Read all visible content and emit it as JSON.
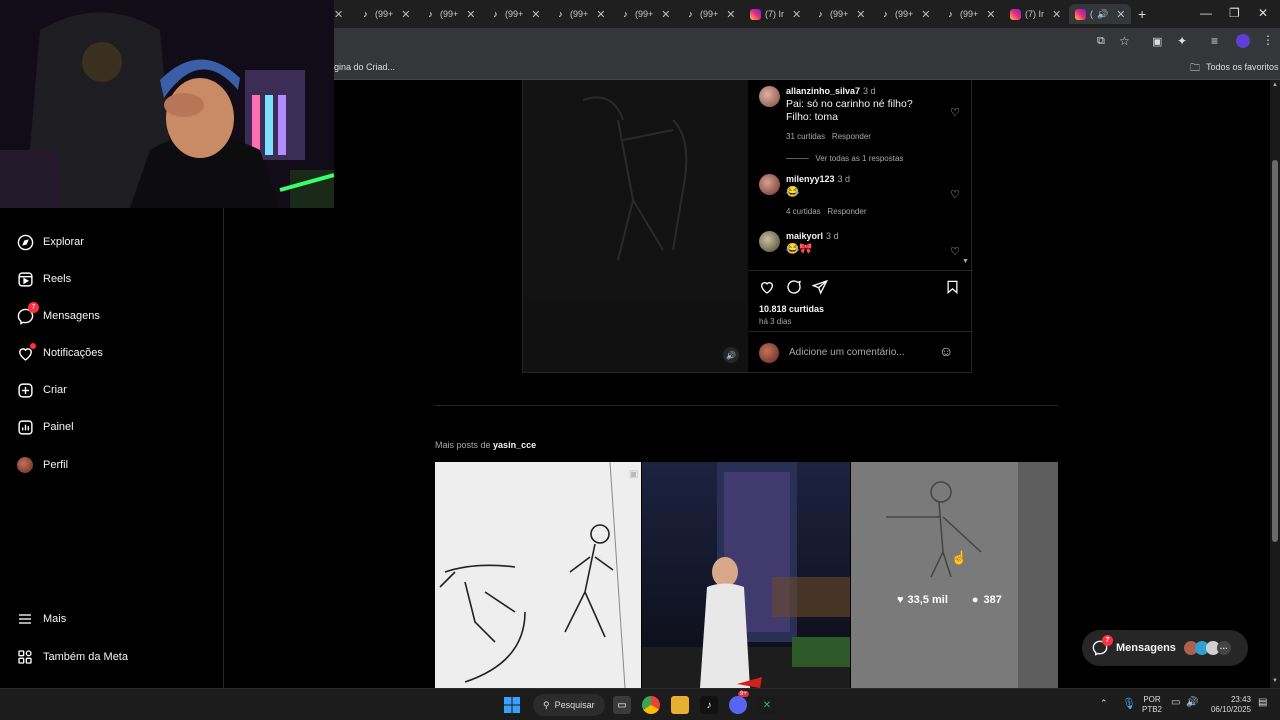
{
  "browser": {
    "tabs": [
      {
        "title": "(99+",
        "kind": "tiktok"
      },
      {
        "title": "(99+",
        "kind": "tiktok"
      },
      {
        "title": "(99+",
        "kind": "tiktok"
      },
      {
        "title": "(99+",
        "kind": "tiktok"
      },
      {
        "title": "(99+",
        "kind": "tiktok"
      },
      {
        "title": "(99+",
        "kind": "tiktok"
      },
      {
        "title": "(7) Ir",
        "kind": "instagram"
      },
      {
        "title": "(99+",
        "kind": "tiktok"
      },
      {
        "title": "(99+",
        "kind": "tiktok"
      },
      {
        "title": "(99+",
        "kind": "tiktok"
      },
      {
        "title": "(7) Ir",
        "kind": "instagram"
      },
      {
        "title": "(",
        "kind": "instagram"
      }
    ],
    "new_tab": "+",
    "bookmark_partial": "gina do Criad...",
    "favorites": "Todos os favoritos"
  },
  "sidebar": {
    "items": [
      {
        "label": "Explorar",
        "icon": "compass-icon"
      },
      {
        "label": "Reels",
        "icon": "reels-icon"
      },
      {
        "label": "Mensagens",
        "icon": "messenger-icon",
        "badge": "7"
      },
      {
        "label": "Notificações",
        "icon": "heart-icon"
      },
      {
        "label": "Criar",
        "icon": "plus-square-icon"
      },
      {
        "label": "Painel",
        "icon": "chart-icon"
      },
      {
        "label": "Perfil",
        "icon": "avatar"
      }
    ],
    "more": "Mais",
    "meta": "Também da Meta"
  },
  "post": {
    "comments": [
      {
        "user": "allanzinho_silva7",
        "time": "3 d",
        "text": "Pai: só no carinho né filho? Filho: toma",
        "likes": "31 curtidas",
        "reply": "Responder",
        "view_replies": "Ver todas as 1 respostas"
      },
      {
        "user": "milenyy123",
        "time": "3 d",
        "text": "😂",
        "likes": "4 curtidas",
        "reply": "Responder"
      },
      {
        "user": "maikyorl",
        "time": "3 d",
        "text": "😂🎀"
      }
    ],
    "likes": "10.818 curtidas",
    "date": "há 3 dias",
    "comment_placeholder": "Adicione um comentário..."
  },
  "more_posts": {
    "prefix": "Mais posts de",
    "user": "yasin_cce",
    "hover_likes": "33,5 mil",
    "hover_comments": "387"
  },
  "messages_pill": {
    "label": "Mensagens",
    "badge": "7"
  },
  "taskbar": {
    "search": "Pesquisar",
    "lang": "POR",
    "layout": "PTB2",
    "time": "23:43",
    "date": "06/10/2025",
    "discord_badge": "9+"
  }
}
